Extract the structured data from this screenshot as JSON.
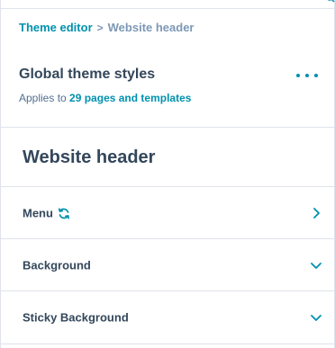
{
  "breadcrumb": {
    "root": "Theme editor",
    "separator": ">",
    "current": "Website header"
  },
  "global": {
    "title": "Global theme styles",
    "applies_prefix": "Applies to",
    "applies_link": "29 pages and templates"
  },
  "section": {
    "title": "Website header"
  },
  "rows": [
    {
      "label": "Menu",
      "icon": "chevron-right-icon",
      "extra_icon": "sync-icon"
    },
    {
      "label": "Background",
      "icon": "chevron-down-icon"
    },
    {
      "label": "Sticky Background",
      "icon": "chevron-down-icon"
    }
  ],
  "colors": {
    "accent": "#0091ae",
    "text": "#33475b",
    "muted": "#7c98b6",
    "border": "#dfe3eb"
  }
}
